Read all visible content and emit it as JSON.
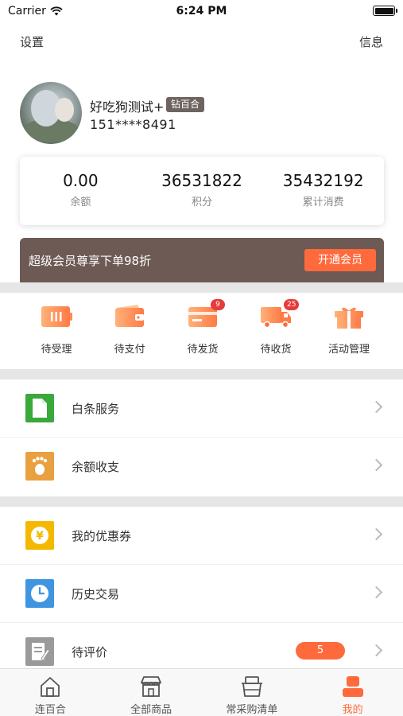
{
  "status_bar": {
    "carrier": "Carrier",
    "time": "6:24 PM"
  },
  "top_nav": {
    "left": "设置",
    "right": "信息"
  },
  "profile": {
    "nickname": "好吃狗测试+",
    "level": "钻百合",
    "phone": "151****8491"
  },
  "stats": [
    {
      "value": "0.00",
      "label": "余额"
    },
    {
      "value": "36531822",
      "label": "积分"
    },
    {
      "value": "35432192",
      "label": "累计消费"
    }
  ],
  "vip_banner": {
    "text": "超级会员尊享下单98折",
    "button": "开通会员"
  },
  "orders": [
    {
      "label": "待受理",
      "icon": "battery-icon",
      "badge": ""
    },
    {
      "label": "待支付",
      "icon": "wallet-icon",
      "badge": ""
    },
    {
      "label": "待发货",
      "icon": "card-icon",
      "badge": "9"
    },
    {
      "label": "待收货",
      "icon": "truck-icon",
      "badge": "25"
    },
    {
      "label": "活动管理",
      "icon": "gift-icon",
      "badge": ""
    }
  ],
  "menu_group_1": [
    {
      "label": "白条服务",
      "icon": "document-icon",
      "color": "#3aa83a"
    },
    {
      "label": "余额收支",
      "icon": "footprint-icon",
      "color": "#e8a040"
    }
  ],
  "menu_group_2": [
    {
      "label": "我的优惠券",
      "icon": "coupon-icon",
      "color": "#f5b800"
    },
    {
      "label": "历史交易",
      "icon": "clock-icon",
      "color": "#3f95e0"
    },
    {
      "label": "待评价",
      "icon": "review-icon",
      "color": "#9a9a9a",
      "badge": "5"
    }
  ],
  "tabbar": [
    {
      "label": "连百合",
      "icon": "home-icon"
    },
    {
      "label": "全部商品",
      "icon": "store-icon"
    },
    {
      "label": "常采购清单",
      "icon": "basket-icon"
    },
    {
      "label": "我的",
      "icon": "user-icon",
      "active": true
    }
  ],
  "colors": {
    "accent": "#ff6a3d",
    "vip_bg": "#6d5a55",
    "badge_red": "#e73a3a",
    "separator": "#e6e6e6"
  }
}
